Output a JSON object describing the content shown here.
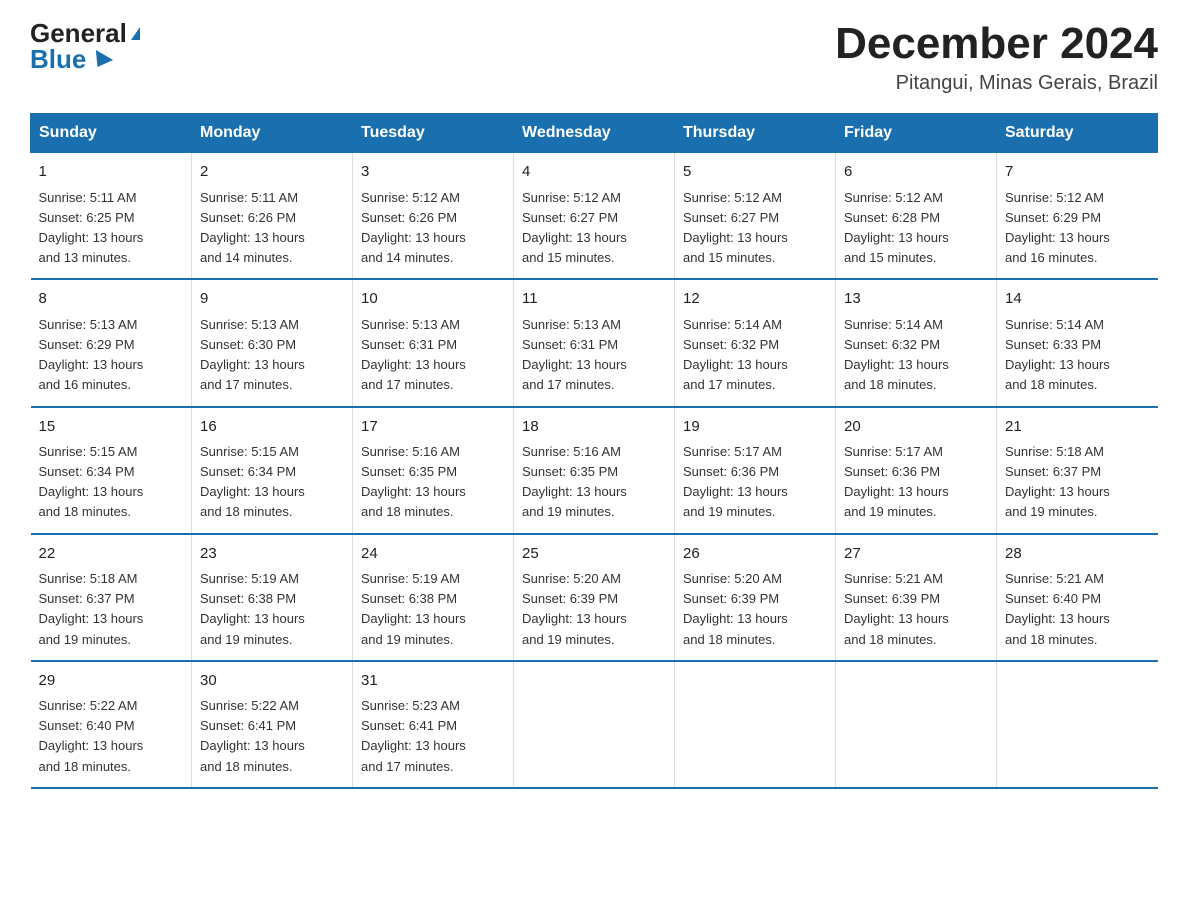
{
  "header": {
    "logo_general": "General",
    "logo_blue": "Blue",
    "month_year": "December 2024",
    "location": "Pitangui, Minas Gerais, Brazil"
  },
  "days_of_week": [
    "Sunday",
    "Monday",
    "Tuesday",
    "Wednesday",
    "Thursday",
    "Friday",
    "Saturday"
  ],
  "weeks": [
    [
      {
        "day": "1",
        "sunrise": "5:11 AM",
        "sunset": "6:25 PM",
        "daylight": "13 hours and 13 minutes."
      },
      {
        "day": "2",
        "sunrise": "5:11 AM",
        "sunset": "6:26 PM",
        "daylight": "13 hours and 14 minutes."
      },
      {
        "day": "3",
        "sunrise": "5:12 AM",
        "sunset": "6:26 PM",
        "daylight": "13 hours and 14 minutes."
      },
      {
        "day": "4",
        "sunrise": "5:12 AM",
        "sunset": "6:27 PM",
        "daylight": "13 hours and 15 minutes."
      },
      {
        "day": "5",
        "sunrise": "5:12 AM",
        "sunset": "6:27 PM",
        "daylight": "13 hours and 15 minutes."
      },
      {
        "day": "6",
        "sunrise": "5:12 AM",
        "sunset": "6:28 PM",
        "daylight": "13 hours and 15 minutes."
      },
      {
        "day": "7",
        "sunrise": "5:12 AM",
        "sunset": "6:29 PM",
        "daylight": "13 hours and 16 minutes."
      }
    ],
    [
      {
        "day": "8",
        "sunrise": "5:13 AM",
        "sunset": "6:29 PM",
        "daylight": "13 hours and 16 minutes."
      },
      {
        "day": "9",
        "sunrise": "5:13 AM",
        "sunset": "6:30 PM",
        "daylight": "13 hours and 17 minutes."
      },
      {
        "day": "10",
        "sunrise": "5:13 AM",
        "sunset": "6:31 PM",
        "daylight": "13 hours and 17 minutes."
      },
      {
        "day": "11",
        "sunrise": "5:13 AM",
        "sunset": "6:31 PM",
        "daylight": "13 hours and 17 minutes."
      },
      {
        "day": "12",
        "sunrise": "5:14 AM",
        "sunset": "6:32 PM",
        "daylight": "13 hours and 17 minutes."
      },
      {
        "day": "13",
        "sunrise": "5:14 AM",
        "sunset": "6:32 PM",
        "daylight": "13 hours and 18 minutes."
      },
      {
        "day": "14",
        "sunrise": "5:14 AM",
        "sunset": "6:33 PM",
        "daylight": "13 hours and 18 minutes."
      }
    ],
    [
      {
        "day": "15",
        "sunrise": "5:15 AM",
        "sunset": "6:34 PM",
        "daylight": "13 hours and 18 minutes."
      },
      {
        "day": "16",
        "sunrise": "5:15 AM",
        "sunset": "6:34 PM",
        "daylight": "13 hours and 18 minutes."
      },
      {
        "day": "17",
        "sunrise": "5:16 AM",
        "sunset": "6:35 PM",
        "daylight": "13 hours and 18 minutes."
      },
      {
        "day": "18",
        "sunrise": "5:16 AM",
        "sunset": "6:35 PM",
        "daylight": "13 hours and 19 minutes."
      },
      {
        "day": "19",
        "sunrise": "5:17 AM",
        "sunset": "6:36 PM",
        "daylight": "13 hours and 19 minutes."
      },
      {
        "day": "20",
        "sunrise": "5:17 AM",
        "sunset": "6:36 PM",
        "daylight": "13 hours and 19 minutes."
      },
      {
        "day": "21",
        "sunrise": "5:18 AM",
        "sunset": "6:37 PM",
        "daylight": "13 hours and 19 minutes."
      }
    ],
    [
      {
        "day": "22",
        "sunrise": "5:18 AM",
        "sunset": "6:37 PM",
        "daylight": "13 hours and 19 minutes."
      },
      {
        "day": "23",
        "sunrise": "5:19 AM",
        "sunset": "6:38 PM",
        "daylight": "13 hours and 19 minutes."
      },
      {
        "day": "24",
        "sunrise": "5:19 AM",
        "sunset": "6:38 PM",
        "daylight": "13 hours and 19 minutes."
      },
      {
        "day": "25",
        "sunrise": "5:20 AM",
        "sunset": "6:39 PM",
        "daylight": "13 hours and 19 minutes."
      },
      {
        "day": "26",
        "sunrise": "5:20 AM",
        "sunset": "6:39 PM",
        "daylight": "13 hours and 18 minutes."
      },
      {
        "day": "27",
        "sunrise": "5:21 AM",
        "sunset": "6:39 PM",
        "daylight": "13 hours and 18 minutes."
      },
      {
        "day": "28",
        "sunrise": "5:21 AM",
        "sunset": "6:40 PM",
        "daylight": "13 hours and 18 minutes."
      }
    ],
    [
      {
        "day": "29",
        "sunrise": "5:22 AM",
        "sunset": "6:40 PM",
        "daylight": "13 hours and 18 minutes."
      },
      {
        "day": "30",
        "sunrise": "5:22 AM",
        "sunset": "6:41 PM",
        "daylight": "13 hours and 18 minutes."
      },
      {
        "day": "31",
        "sunrise": "5:23 AM",
        "sunset": "6:41 PM",
        "daylight": "13 hours and 17 minutes."
      },
      null,
      null,
      null,
      null
    ]
  ],
  "labels": {
    "sunrise": "Sunrise:",
    "sunset": "Sunset:",
    "daylight": "Daylight:"
  }
}
